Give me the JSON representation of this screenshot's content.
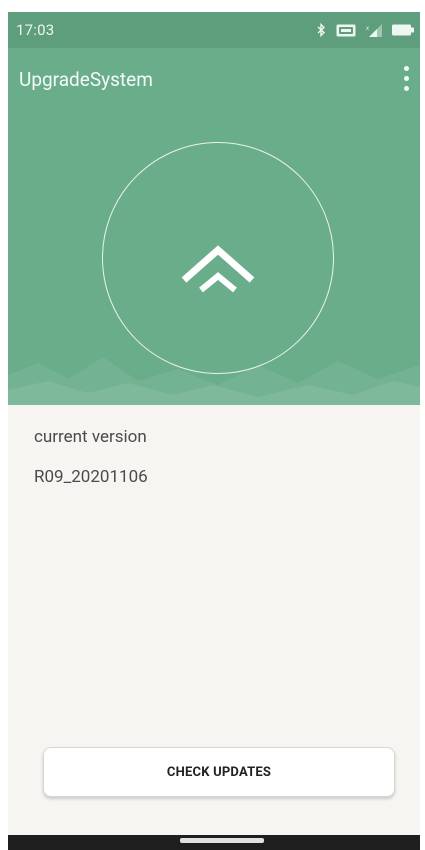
{
  "status_bar": {
    "time": "17:03",
    "icons": [
      "bluetooth-icon",
      "nfc-icon",
      "signal-icon",
      "battery-icon"
    ]
  },
  "app_bar": {
    "title": "UpgradeSystem",
    "menu_icon": "more-vert-icon"
  },
  "hero": {
    "icon": "double-chevron-up-icon"
  },
  "version": {
    "label": "current version",
    "value": "R09_20201106"
  },
  "actions": {
    "check_updates_label": "CHECK UPDATES"
  },
  "colors": {
    "header": "#69ad8b",
    "status_bar": "#5f9e7c",
    "background": "#f7f5f2"
  }
}
